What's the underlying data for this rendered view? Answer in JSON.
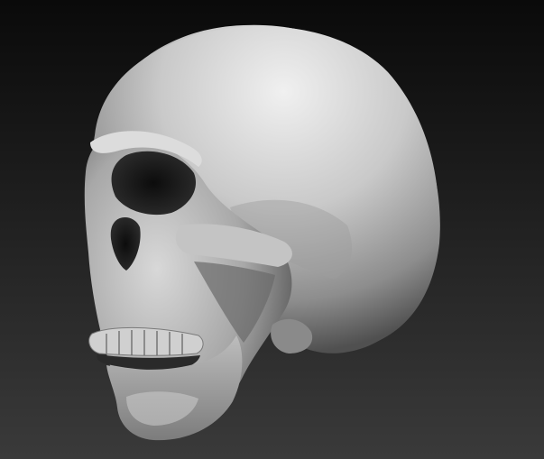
{
  "scene": {
    "subject_icon": "skull-3d-render-icon",
    "colors": {
      "background_top": "#0a0a0a",
      "background_bottom": "#3a3a3a",
      "material_light": "#e6e6e6",
      "material_mid": "#b3b3b3",
      "material_dark": "#5a5a5a",
      "cavity": "#151515"
    }
  }
}
